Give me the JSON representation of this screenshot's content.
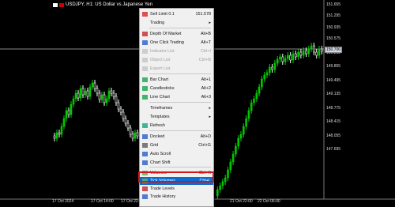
{
  "chart": {
    "title": "USDJPY, H1:  US Dollar vs Japanese Yen",
    "current_price": "150.706",
    "y_ticks": [
      "151.655",
      "151.295",
      "150.935",
      "150.706",
      "150.575",
      "150.215",
      "149.855",
      "149.495",
      "149.135",
      "148.775",
      "148.415",
      "148.055",
      "147.695"
    ],
    "x_ticks": [
      "17 Oct 2024",
      "17 Oct 14:00",
      "17 Oct 22:00",
      "18 Oct",
      "21 Oct 22:00",
      "22 Oct 06:00"
    ],
    "colors": {
      "bull": "#00c800",
      "bear": "#ffffff",
      "background": "#000000"
    }
  },
  "menu": {
    "items": [
      {
        "label": "Sell Limit 0.1",
        "shortcut": "151.578",
        "icon": "sell-limit-icon"
      },
      {
        "label": "Trading",
        "submenu": true
      },
      {
        "label": "Depth Of Market",
        "shortcut": "Alt+B",
        "icon": "depth-of-market-icon"
      },
      {
        "label": "One Click Trading",
        "shortcut": "Alt+T",
        "icon": "one-click-trading-icon"
      },
      {
        "label": "Indicator List",
        "shortcut": "Ctrl+I",
        "disabled": true,
        "icon": "indicator-list-icon"
      },
      {
        "label": "Object List",
        "shortcut": "Ctrl+B",
        "disabled": true,
        "icon": "object-list-icon"
      },
      {
        "label": "Expert List",
        "disabled": true,
        "icon": "expert-list-icon"
      },
      {
        "label": "Bar Chart",
        "shortcut": "Alt+1",
        "icon": "bar-chart-icon"
      },
      {
        "label": "Candlesticks",
        "shortcut": "Alt+2",
        "icon": "candlesticks-icon"
      },
      {
        "label": "Line Chart",
        "shortcut": "Alt+3",
        "icon": "line-chart-icon"
      },
      {
        "label": "Timeframes",
        "submenu": true
      },
      {
        "label": "Templates",
        "submenu": true
      },
      {
        "label": "Refresh",
        "icon": "refresh-icon"
      },
      {
        "label": "Docked",
        "shortcut": "Alt+D",
        "icon": "docked-icon"
      },
      {
        "label": "Grid",
        "shortcut": "Ctrl+G",
        "icon": "grid-icon"
      },
      {
        "label": "Auto Scroll",
        "icon": "auto-scroll-icon"
      },
      {
        "label": "Chart Shift",
        "icon": "chart-shift-icon"
      },
      {
        "label": "Volumes",
        "shortcut": "Ctrl+K",
        "icon": "volumes-icon"
      },
      {
        "label": "Tick Volumes",
        "shortcut": "Ctrl+L",
        "highlighted": true,
        "icon": "tick-volumes-icon"
      },
      {
        "label": "Trade Levels",
        "icon": "trade-levels-icon"
      },
      {
        "label": "Trade History",
        "icon": "trade-history-icon"
      }
    ]
  }
}
